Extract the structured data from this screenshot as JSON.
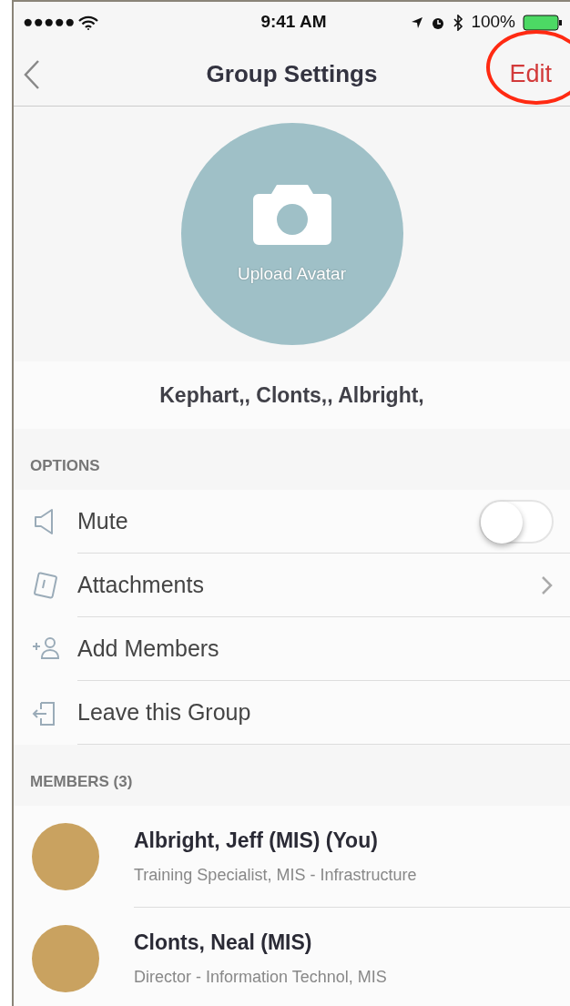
{
  "status_bar": {
    "signal_dots": "●●●●●",
    "time": "9:41 AM",
    "battery": "100%"
  },
  "nav": {
    "title": "Group Settings",
    "action": "Edit",
    "action_highlighted": true
  },
  "avatar": {
    "label": "Upload Avatar"
  },
  "group_name": "Kephart,, Clonts,, Albright,",
  "options": {
    "header": "OPTIONS",
    "items": [
      {
        "kind": "toggle",
        "label": "Mute",
        "on": false
      },
      {
        "kind": "chevron",
        "label": "Attachments"
      },
      {
        "kind": "plain",
        "label": "Add Members"
      },
      {
        "kind": "plain",
        "label": "Leave this Group"
      }
    ]
  },
  "members": {
    "header": "MEMBERS (3)",
    "items": [
      {
        "name": "Albright, Jeff (MIS) (You)",
        "role": "Training Specialist, MIS - Infrastructure"
      },
      {
        "name": "Clonts, Neal (MIS)",
        "role": "Director - Information Technol, MIS"
      }
    ]
  }
}
